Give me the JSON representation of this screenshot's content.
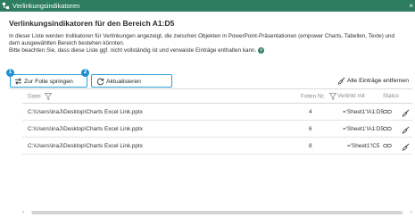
{
  "window": {
    "title": "Verlinkungsindikatoren",
    "close_glyph": "×",
    "icon": "link-indicator-icon"
  },
  "heading": "Verlinkungsindikatoren für den Bereich A1:D5",
  "description": {
    "line1": "In dieser Liste werden Indikatoren für Verlinkungen angezeigt, die zwischen Objekten in PowerPoint-Präsentationen (empower Charts, Tabellen, Texte) und",
    "line2": "dem ausgewählten Bereich bestehen könnten.",
    "line3": "Bitte beachten Sie, dass diese Liste ggf. nicht vollständig ist und verwaiste Einträge enthalten kann."
  },
  "toolbar": {
    "jump_label": "Zur Folie springen",
    "refresh_label": "Aktualisieren",
    "remove_all_label": "Alle Einträge entfernen",
    "badge_1": "1",
    "badge_2": "2"
  },
  "table": {
    "columns": {
      "file": "Datei",
      "slides": "Folien Nr.",
      "linked": "Verlinkt mit",
      "status": "Status"
    },
    "rows": [
      {
        "file": "C:\\Users\\inaJ\\Desktop\\Charts Excel Link.pptx",
        "slides": "4",
        "linked": "='Sheet1'!A1:D5",
        "status_icon": "link-icon",
        "action_icon": "broom-icon"
      },
      {
        "file": "C:\\Users\\inaJ\\Desktop\\Charts Excel Link.pptx",
        "slides": "6",
        "linked": "='Sheet1'!A1:D5",
        "status_icon": "link-icon",
        "action_icon": "broom-icon"
      },
      {
        "file": "C:\\Users\\inaJ\\Desktop\\Charts Excel Link.pptx",
        "slides": "8",
        "linked": "='Sheet1'!C5",
        "status_icon": "link-icon",
        "action_icon": "broom-icon"
      }
    ]
  },
  "scrollbar": {
    "left_arrow": "‹",
    "right_arrow": "›"
  },
  "colors": {
    "titlebar": "#2f7d60",
    "highlight": "#2e9fd6",
    "badge": "#1a8fd1"
  }
}
